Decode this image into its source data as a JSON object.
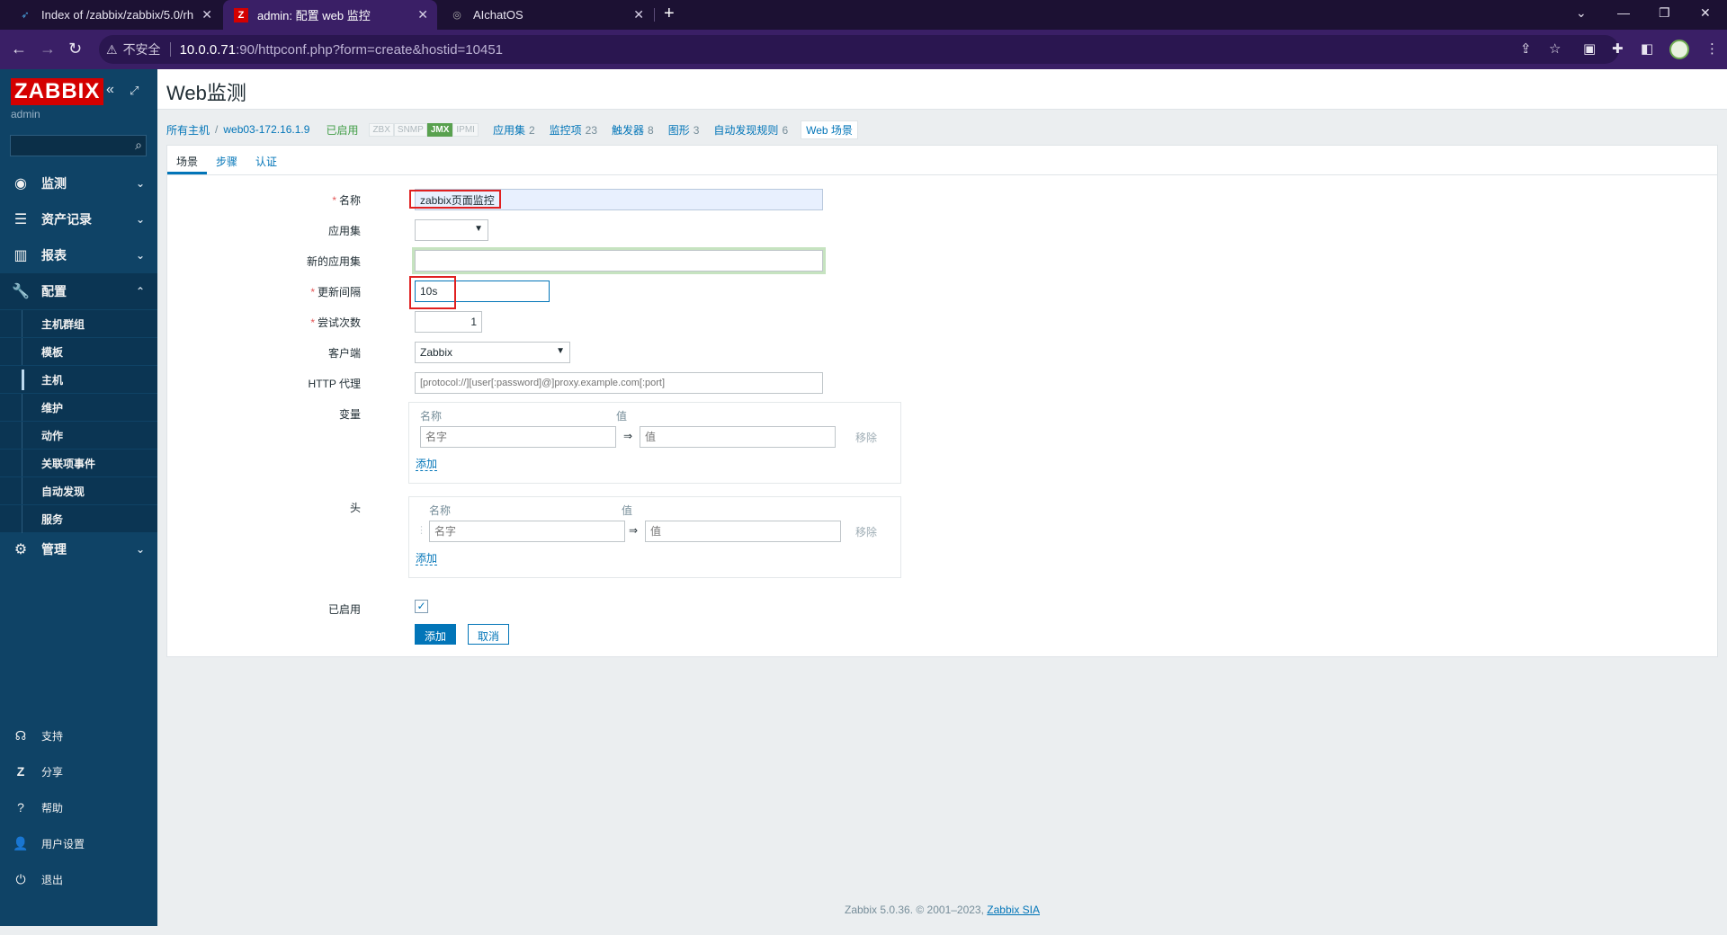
{
  "browser": {
    "tabs": [
      {
        "title": "Index of /zabbix/zabbix/5.0/rh",
        "active": false
      },
      {
        "title": "admin: 配置 web 监控",
        "active": true
      },
      {
        "title": "AIchatOS",
        "active": false
      }
    ],
    "address": {
      "security_label": "不安全",
      "host": "10.0.0.71",
      "path": ":90/httpconf.php?form=create&hostid=10451"
    }
  },
  "sidebar": {
    "logo": "ZABBIX",
    "user": "admin",
    "menu": [
      {
        "label": "监测",
        "icon": "eye-icon"
      },
      {
        "label": "资产记录",
        "icon": "list-icon"
      },
      {
        "label": "报表",
        "icon": "bar-chart-icon"
      },
      {
        "label": "配置",
        "icon": "wrench-icon"
      },
      {
        "label": "管理",
        "icon": "gear-icon"
      }
    ],
    "config_submenu": [
      "主机群组",
      "模板",
      "主机",
      "维护",
      "动作",
      "关联项事件",
      "自动发现",
      "服务"
    ],
    "bottom": [
      "支持",
      "分享",
      "帮助",
      "用户设置",
      "退出"
    ]
  },
  "page": {
    "title": "Web监测"
  },
  "breadcrumbs": {
    "all_hosts": "所有主机",
    "host": "web03-172.16.1.9",
    "status": "已启用",
    "availability": [
      "ZBX",
      "SNMP",
      "JMX",
      "IPMI"
    ],
    "links": [
      {
        "label": "应用集",
        "count": "2"
      },
      {
        "label": "监控项",
        "count": "23"
      },
      {
        "label": "触发器",
        "count": "8"
      },
      {
        "label": "图形",
        "count": "3"
      },
      {
        "label": "自动发现规则",
        "count": "6"
      }
    ],
    "current": "Web 场景"
  },
  "form_tabs": [
    "场景",
    "步骤",
    "认证"
  ],
  "form": {
    "name_label": "名称",
    "name_value": "zabbix页面监控",
    "app_label": "应用集",
    "new_app_label": "新的应用集",
    "new_app_value": "",
    "interval_label": "更新间隔",
    "interval_value": "10s",
    "attempts_label": "尝试次数",
    "attempts_value": "1",
    "agent_label": "客户端",
    "agent_value": "Zabbix",
    "proxy_label": "HTTP 代理",
    "proxy_placeholder": "[protocol://][user[:password]@]proxy.example.com[:port]",
    "variables_label": "变量",
    "headers_label": "头",
    "col_name": "名称",
    "col_value": "值",
    "name_placeholder": "名字",
    "value_placeholder": "值",
    "arrow": "⇒",
    "remove": "移除",
    "add_link": "添加",
    "enabled_label": "已启用",
    "enabled": true,
    "submit": "添加",
    "cancel": "取消"
  },
  "footer": {
    "text": "Zabbix 5.0.36. © 2001–2023,",
    "link": "Zabbix SIA"
  }
}
